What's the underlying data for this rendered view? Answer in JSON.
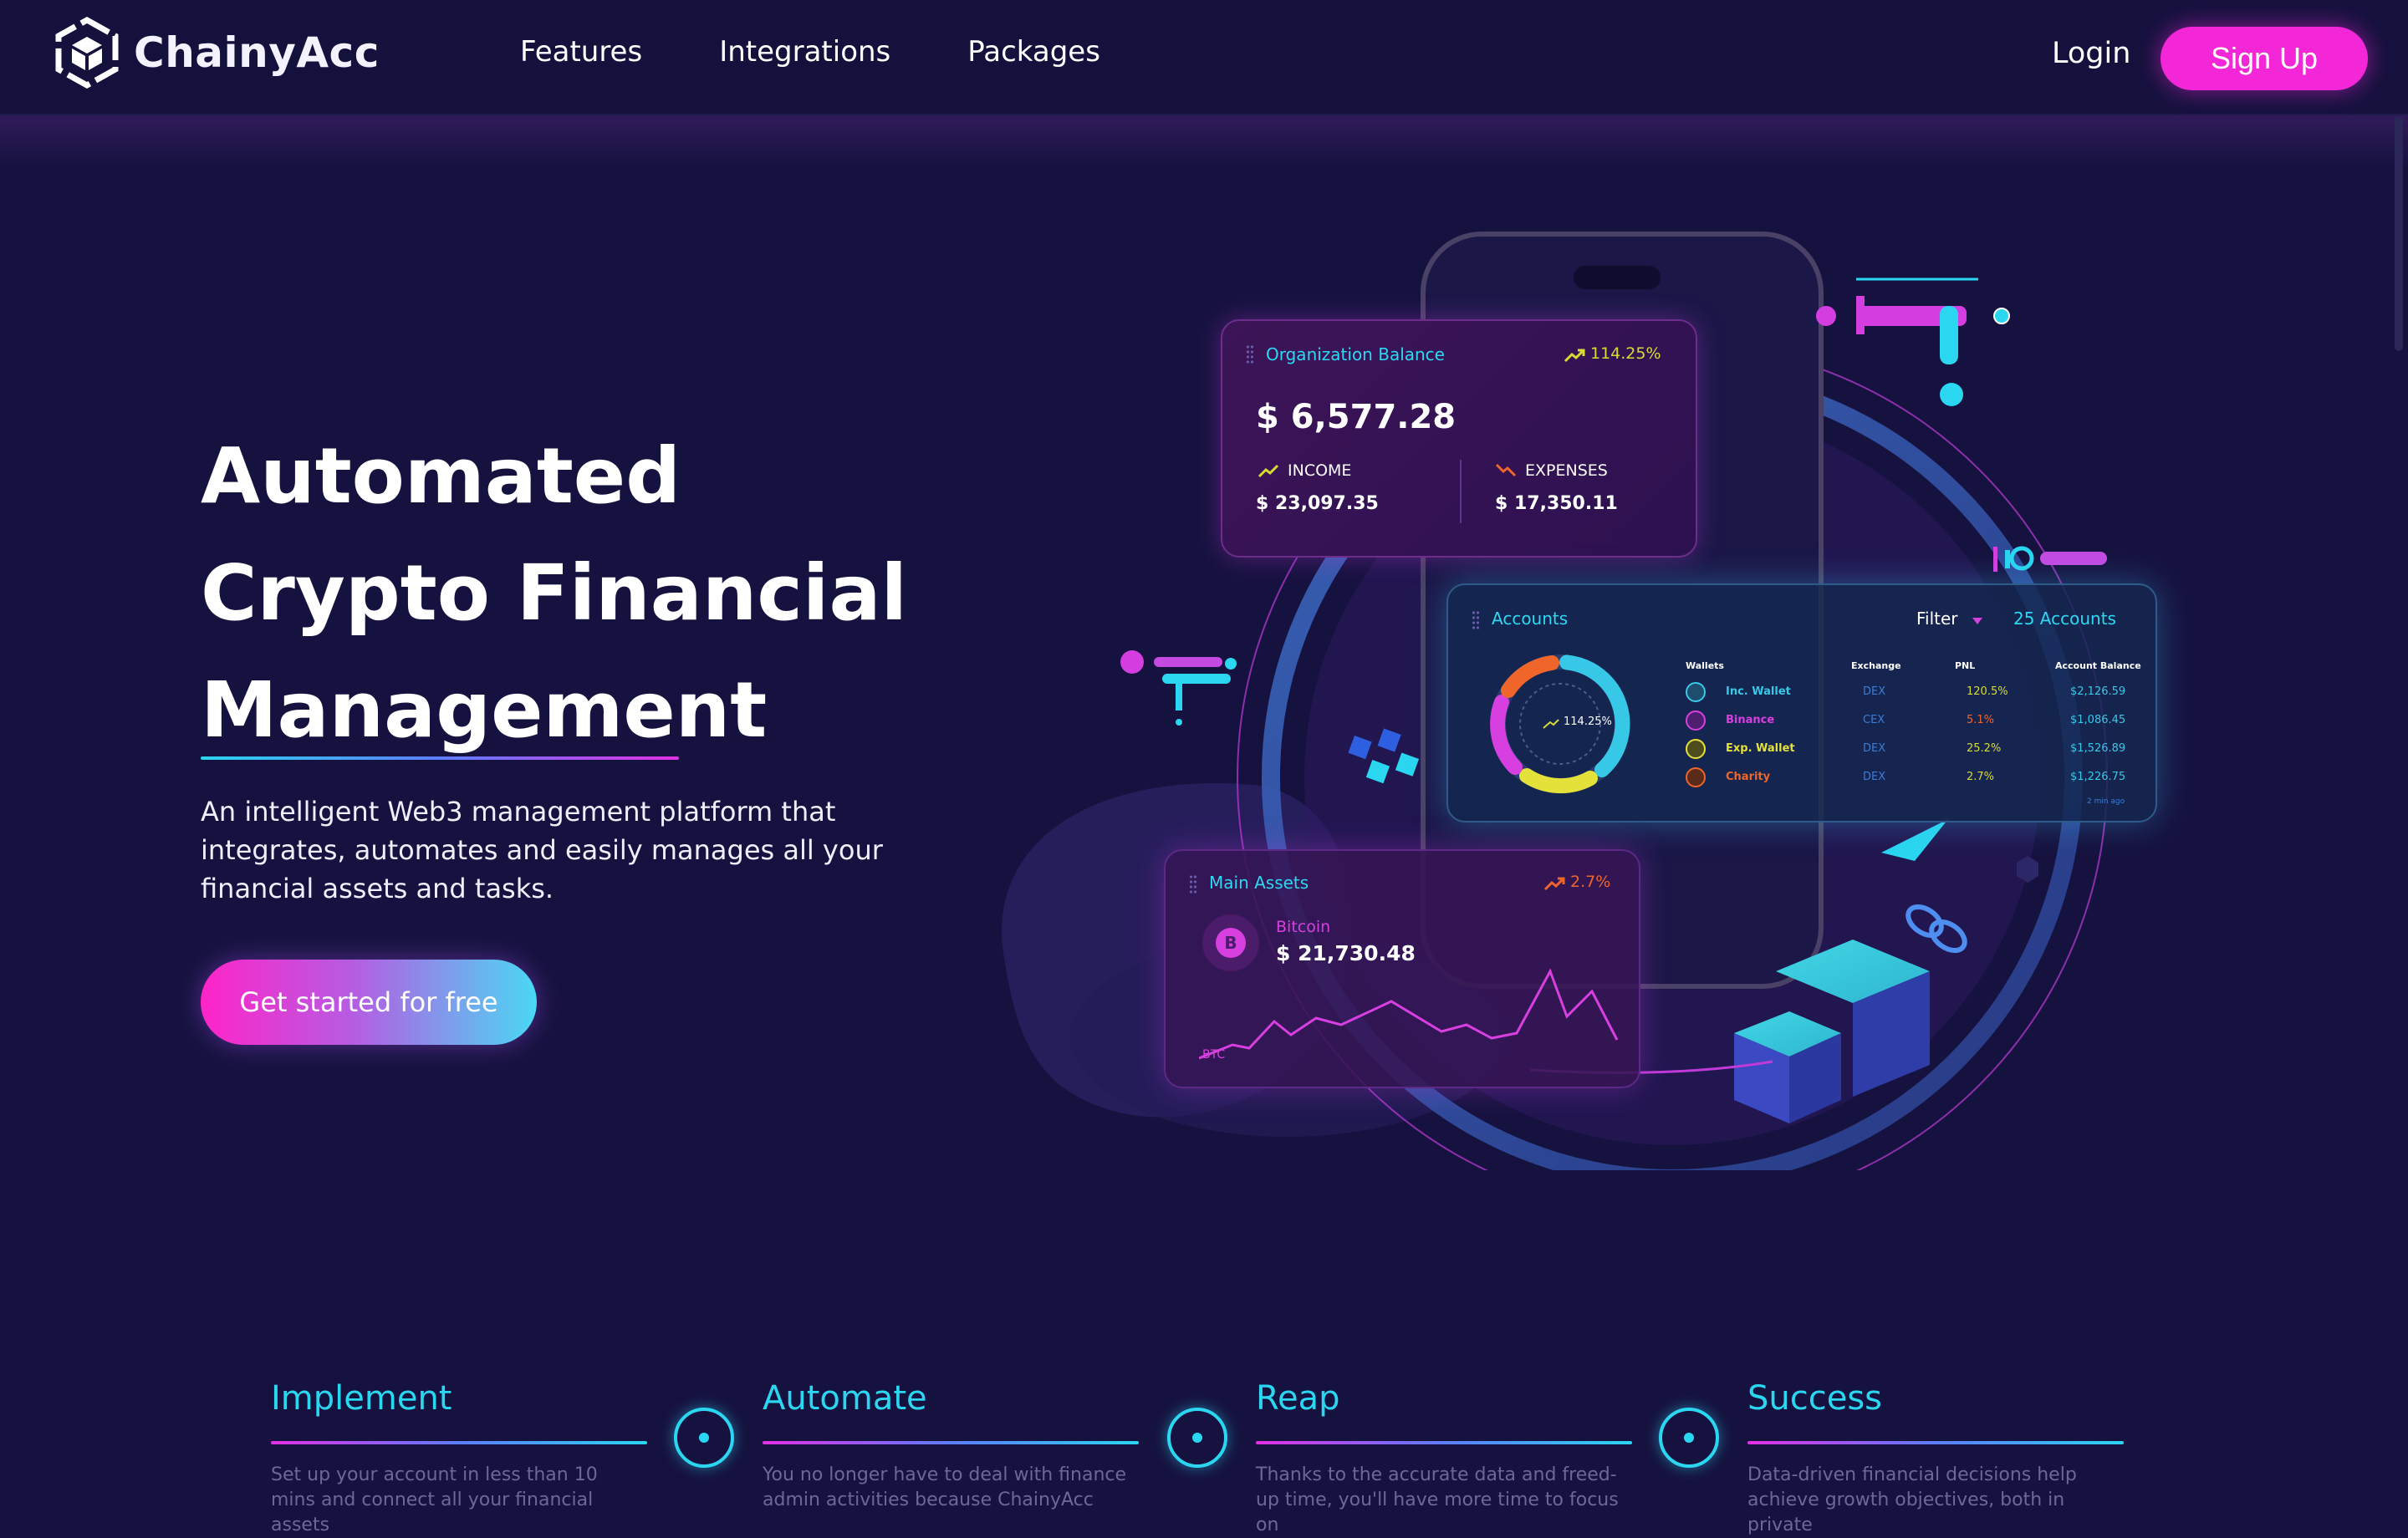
{
  "header": {
    "brand": "ChainyAcc",
    "nav": [
      "Features",
      "Integrations",
      "Packages"
    ],
    "login": "Login",
    "signup": "Sign Up"
  },
  "hero": {
    "title_lines": [
      "Automated",
      "Crypto Financial",
      "Management"
    ],
    "description": "An intelligent Web3 management platform that integrates, automates and easily manages all your financial assets and tasks.",
    "cta": "Get started for free"
  },
  "illustration": {
    "org_card": {
      "title": "Organization Balance",
      "change": "114.25%",
      "balance": "$ 6,577.28",
      "income_label": "INCOME",
      "income_value": "$ 23,097.35",
      "expenses_label": "EXPENSES",
      "expenses_value": "$ 17,350.11"
    },
    "accounts_card": {
      "title": "Accounts",
      "filter": "Filter",
      "count": "25 Accounts",
      "donut_label": "114.25%",
      "headers": [
        "Wallets",
        "Exchange",
        "PNL",
        "Account Balance"
      ],
      "rows": [
        {
          "wallet": "Inc. Wallet",
          "exchange": "DEX",
          "pnl": "120.5%",
          "balance": "$2,126.59",
          "color": "#37c8e8"
        },
        {
          "wallet": "Binance",
          "exchange": "CEX",
          "pnl": "5.1%",
          "balance": "$1,086.45",
          "color": "#d83fe0"
        },
        {
          "wallet": "Exp. Wallet",
          "exchange": "DEX",
          "pnl": "25.2%",
          "balance": "$1,526.89",
          "color": "#e4e13a"
        },
        {
          "wallet": "Charity",
          "exchange": "DEX",
          "pnl": "2.7%",
          "balance": "$1,226.75",
          "color": "#f0662a"
        }
      ],
      "updated": "2 min ago"
    },
    "main_card": {
      "title": "Main Assets",
      "change": "2.7%",
      "asset": "Bitcoin",
      "value": "$ 21,730.48",
      "ticker": "BTC"
    }
  },
  "steps": [
    {
      "title": "Implement",
      "text": "Set up your account in less than 10 mins and connect all your financial assets"
    },
    {
      "title": "Automate",
      "text": "You no longer have to deal with finance admin activities because ChainyAcc"
    },
    {
      "title": "Reap",
      "text": "Thanks to the accurate data and freed-up time, you'll have more time to focus on"
    },
    {
      "title": "Success",
      "text": "Data-driven financial decisions help achieve growth objectives, both in private"
    }
  ],
  "colors": {
    "background": "#16123f",
    "accent_pink": "#f327d8",
    "accent_cyan": "#2ad6f0"
  }
}
